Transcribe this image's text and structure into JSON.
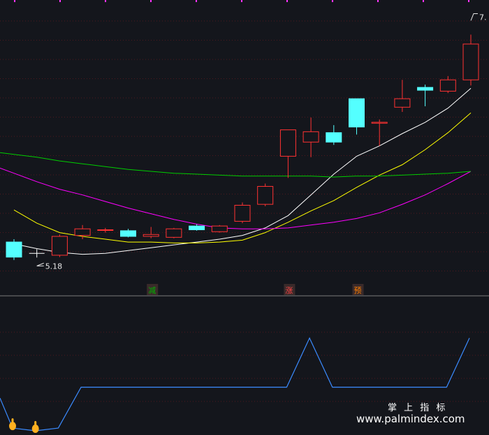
{
  "chart_data": {
    "type": "candlestick",
    "price_panel": {
      "ylim": [
        4.9,
        7.6
      ],
      "candles": [
        {
          "o": 5.3,
          "h": 5.33,
          "l": 5.11,
          "c": 5.14
        },
        {
          "o": 5.18,
          "h": 5.18,
          "l": 5.18,
          "c": 5.18
        },
        {
          "o": 5.16,
          "h": 5.38,
          "l": 5.14,
          "c": 5.36
        },
        {
          "o": 5.37,
          "h": 5.48,
          "l": 5.33,
          "c": 5.44
        },
        {
          "o": 5.43,
          "h": 5.45,
          "l": 5.4,
          "c": 5.43
        },
        {
          "o": 5.42,
          "h": 5.44,
          "l": 5.35,
          "c": 5.36
        },
        {
          "o": 5.36,
          "h": 5.46,
          "l": 5.34,
          "c": 5.38
        },
        {
          "o": 5.35,
          "h": 5.45,
          "l": 5.34,
          "c": 5.44
        },
        {
          "o": 5.47,
          "h": 5.49,
          "l": 5.42,
          "c": 5.43
        },
        {
          "o": 5.41,
          "h": 5.48,
          "l": 5.4,
          "c": 5.47
        },
        {
          "o": 5.52,
          "h": 5.72,
          "l": 5.5,
          "c": 5.69
        },
        {
          "o": 5.7,
          "h": 5.92,
          "l": 5.68,
          "c": 5.89
        },
        {
          "o": 6.21,
          "h": 6.21,
          "l": 5.98,
          "c": 6.49
        },
        {
          "o": 6.36,
          "h": 6.62,
          "l": 6.2,
          "c": 6.47
        },
        {
          "o": 6.46,
          "h": 6.54,
          "l": 6.33,
          "c": 6.36
        },
        {
          "o": 6.82,
          "h": 6.82,
          "l": 6.44,
          "c": 6.52
        },
        {
          "o": 6.56,
          "h": 6.6,
          "l": 6.32,
          "c": 6.57
        },
        {
          "o": 6.73,
          "h": 7.02,
          "l": 6.68,
          "c": 6.82
        },
        {
          "o": 6.94,
          "h": 6.97,
          "l": 6.74,
          "c": 6.91
        },
        {
          "o": 6.9,
          "h": 7.06,
          "l": 6.88,
          "c": 7.02
        },
        {
          "o": 7.02,
          "h": 7.5,
          "l": 6.96,
          "c": 7.4
        }
      ],
      "ma_lines": [
        {
          "color": "#ffffff",
          "values": [
            5.28,
            5.23,
            5.19,
            5.17,
            5.18,
            5.21,
            5.24,
            5.27,
            5.3,
            5.33,
            5.37,
            5.45,
            5.58,
            5.8,
            6.02,
            6.21,
            6.32,
            6.45,
            6.57,
            6.72,
            6.93
          ]
        },
        {
          "color": "#ffff00",
          "values": [
            5.64,
            5.5,
            5.4,
            5.36,
            5.33,
            5.3,
            5.3,
            5.29,
            5.29,
            5.3,
            5.32,
            5.4,
            5.51,
            5.63,
            5.74,
            5.88,
            6.01,
            6.12,
            6.28,
            6.46,
            6.67
          ]
        },
        {
          "color": "#ff00ff",
          "values": [
            6.03,
            5.94,
            5.86,
            5.8,
            5.73,
            5.66,
            5.6,
            5.54,
            5.49,
            5.45,
            5.44,
            5.44,
            5.45,
            5.48,
            5.51,
            5.55,
            5.61,
            5.7,
            5.8,
            5.92,
            6.05
          ]
        },
        {
          "color": "#00cc00",
          "values": [
            6.23,
            6.2,
            6.16,
            6.13,
            6.1,
            6.07,
            6.05,
            6.03,
            6.02,
            6.01,
            6.0,
            6.0,
            6.0,
            6.0,
            5.99,
            6.0,
            6.0,
            6.01,
            6.02,
            6.03,
            6.05
          ]
        }
      ],
      "low_label": "5.18",
      "high_label": "7.",
      "signals": [
        {
          "index": 6,
          "label": "减",
          "color": "#00b200"
        },
        {
          "index": 12,
          "label": "涨",
          "color": "#ff4444"
        },
        {
          "index": 15,
          "label": "预",
          "color": "#ff7f00"
        }
      ]
    },
    "indicator_panel": {
      "ylim": [
        0,
        4
      ],
      "color": "#3b8bff",
      "values": [
        0.1,
        0,
        0.1,
        1.6,
        1.6,
        1.6,
        1.6,
        1.6,
        1.6,
        1.6,
        1.6,
        1.6,
        1.6,
        3.4,
        1.6,
        1.6,
        1.6,
        1.6,
        1.6,
        1.6,
        3.4
      ],
      "markers": [
        0,
        1
      ]
    }
  },
  "watermark": {
    "cn": "掌 上 指 标",
    "url": "www.palmindex.com"
  },
  "colors": {
    "up": "#ff3232",
    "down": "#54ffff",
    "grid": "#8a1a20",
    "separator": "#7a7a7a",
    "marker": "#ffb020"
  },
  "icons": {
    "indicator_marker": "hand-pointer-icon"
  }
}
